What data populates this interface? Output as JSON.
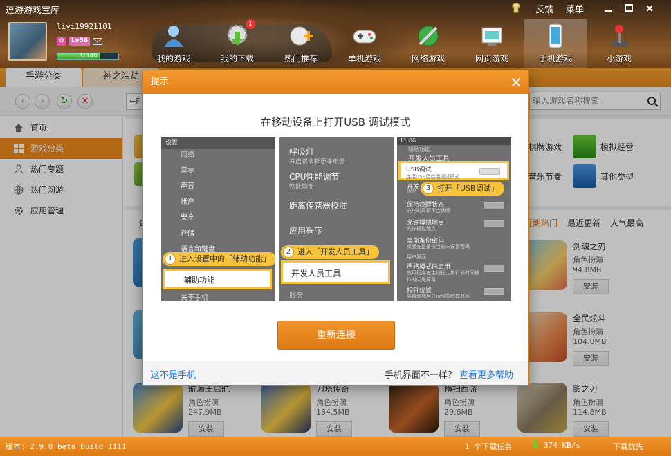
{
  "app": {
    "title": "逗游游戏宝库",
    "feedback": "反馈",
    "menu": "菜单"
  },
  "user": {
    "name": "liyi19921101",
    "level": "Lv58",
    "exp": "31146",
    "exp_fraction": 0.7
  },
  "nav": [
    {
      "label": "我的游戏"
    },
    {
      "label": "我的下载",
      "badge": "1"
    },
    {
      "label": "热门推荐"
    },
    {
      "label": "单机游戏"
    },
    {
      "label": "网络游戏"
    },
    {
      "label": "网页游戏"
    },
    {
      "label": "手机游戏"
    },
    {
      "label": "小游戏"
    }
  ],
  "tabs": [
    "手游分类",
    "神之浩劫"
  ],
  "toolbar": {
    "url_prefix": "←F",
    "search_placeholder": "输入游戏名称搜索"
  },
  "sidebar": [
    {
      "label": "首页"
    },
    {
      "label": "游戏分类"
    },
    {
      "label": "热门专题"
    },
    {
      "label": "热门网游"
    },
    {
      "label": "应用管理"
    }
  ],
  "categories": [
    {
      "label": "棋牌游戏"
    },
    {
      "label": "模拟经营"
    },
    {
      "label": "音乐节奏"
    },
    {
      "label": "其他类型"
    }
  ],
  "list_head": "角",
  "sort_tabs": [
    "近期热门",
    "最近更新",
    "人气最高"
  ],
  "games": [
    {
      "name": "剑魂之刃",
      "genre": "角色扮演",
      "size": "94.8MB",
      "install": "安装"
    },
    {
      "name": "全民炫斗",
      "genre": "角色扮演",
      "size": "104.8MB",
      "install": "安装"
    },
    {
      "name": "航海王启航",
      "genre": "角色扮演",
      "size": "247.9MB",
      "install": "安装"
    },
    {
      "name": "刀塔传奇",
      "genre": "角色扮演",
      "size": "134.5MB",
      "install": "安装"
    },
    {
      "name": "横扫西游",
      "genre": "角色扮演",
      "size": "29.6MB",
      "install": "安装"
    },
    {
      "name": "影之刃",
      "genre": "角色扮演",
      "size": "114.8MB",
      "install": "安装"
    }
  ],
  "status": {
    "version": "版本: 2.9.0 beta build 1111",
    "tasks": "1 个下载任务",
    "speed": "374 KB/s",
    "priority": "下载优先"
  },
  "dialog": {
    "title": "提示",
    "heading": "在移动设备上打开USB 调试模式",
    "shot1": {
      "header": "设置",
      "rows": [
        "网络",
        "显示",
        "声音",
        "账户",
        "安全",
        "存储",
        "语言和键盘",
        "辅助功能",
        "关于手机"
      ],
      "step": "1",
      "step_text": "进入设置中的「辅助功能」"
    },
    "shot2": {
      "rows": [
        {
          "title": "呼吸灯",
          "sub": "开启将消耗更多电量"
        },
        {
          "title": "CPU性能调节",
          "sub": "性能均衡"
        },
        {
          "title": "距离传感器校准",
          "sub": ""
        },
        {
          "title": "应用程序",
          "sub": ""
        },
        {
          "title": "电",
          "sub": ""
        },
        {
          "title": "开发人员工具",
          "sub": ""
        },
        {
          "title": "服务",
          "sub": ""
        }
      ],
      "step": "2",
      "step_text": "进入「开发人员工具」"
    },
    "shot3": {
      "time": "11:06",
      "crumb": "辅助功能",
      "header": "开发人员工具",
      "usb_title": "USB调试",
      "usb_sub": "连接USB后启用调试模式",
      "rows": [
        {
          "title": "开发",
          "sub": "IMM"
        },
        {
          "title": "保持唤醒状态",
          "sub": "充电时屏幕不会休眠"
        },
        {
          "title": "允许模拟地点",
          "sub": "允许模拟地点"
        },
        {
          "title": "桌面备份密码",
          "sub": "桌面完整备份当前未设置密码"
        },
        {
          "title": "用户界面",
          "sub": ""
        },
        {
          "title": "严格模式已启用",
          "sub": "应用程序在主线程上执行长时间操作时闪烁屏幕"
        },
        {
          "title": "指针位置",
          "sub": "屏幕叠加层显示当前触摸数据"
        }
      ],
      "step": "3",
      "step_text": "打开「USB调试」"
    },
    "reconnect": "重新连接",
    "not_phone": "这不是手机",
    "diff_ui": "手机界面不一样？",
    "more_help": "查看更多帮助"
  }
}
